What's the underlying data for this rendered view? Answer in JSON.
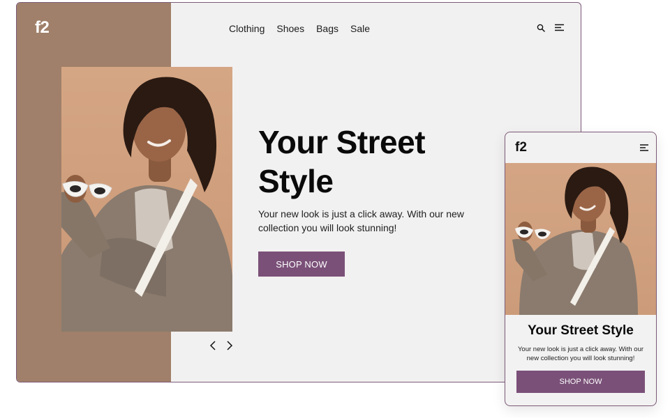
{
  "desktop": {
    "logo": "f2",
    "nav": [
      {
        "label": "Clothing"
      },
      {
        "label": "Shoes"
      },
      {
        "label": "Bags"
      },
      {
        "label": "Sale"
      }
    ],
    "icons": {
      "search": "search-icon",
      "menu": "menu-icon",
      "prev": "chevron-left-icon",
      "next": "chevron-right-icon"
    },
    "hero": {
      "title": "Your Street Style",
      "subtitle": "Your new look is just a click away. With our new collection you will look stunning!",
      "cta": "SHOP NOW"
    }
  },
  "mobile": {
    "logo": "f2",
    "icons": {
      "menu": "menu-icon"
    },
    "hero": {
      "title": "Your Street Style",
      "subtitle": "Your new look is just a click away. With our new collection you will look stunning!",
      "cta": "SHOP NOW"
    }
  },
  "colors": {
    "accent": "#7a5078",
    "sidebar": "#a0806a",
    "background": "#f2f1f1",
    "photo_backdrop": "#d5a684"
  }
}
